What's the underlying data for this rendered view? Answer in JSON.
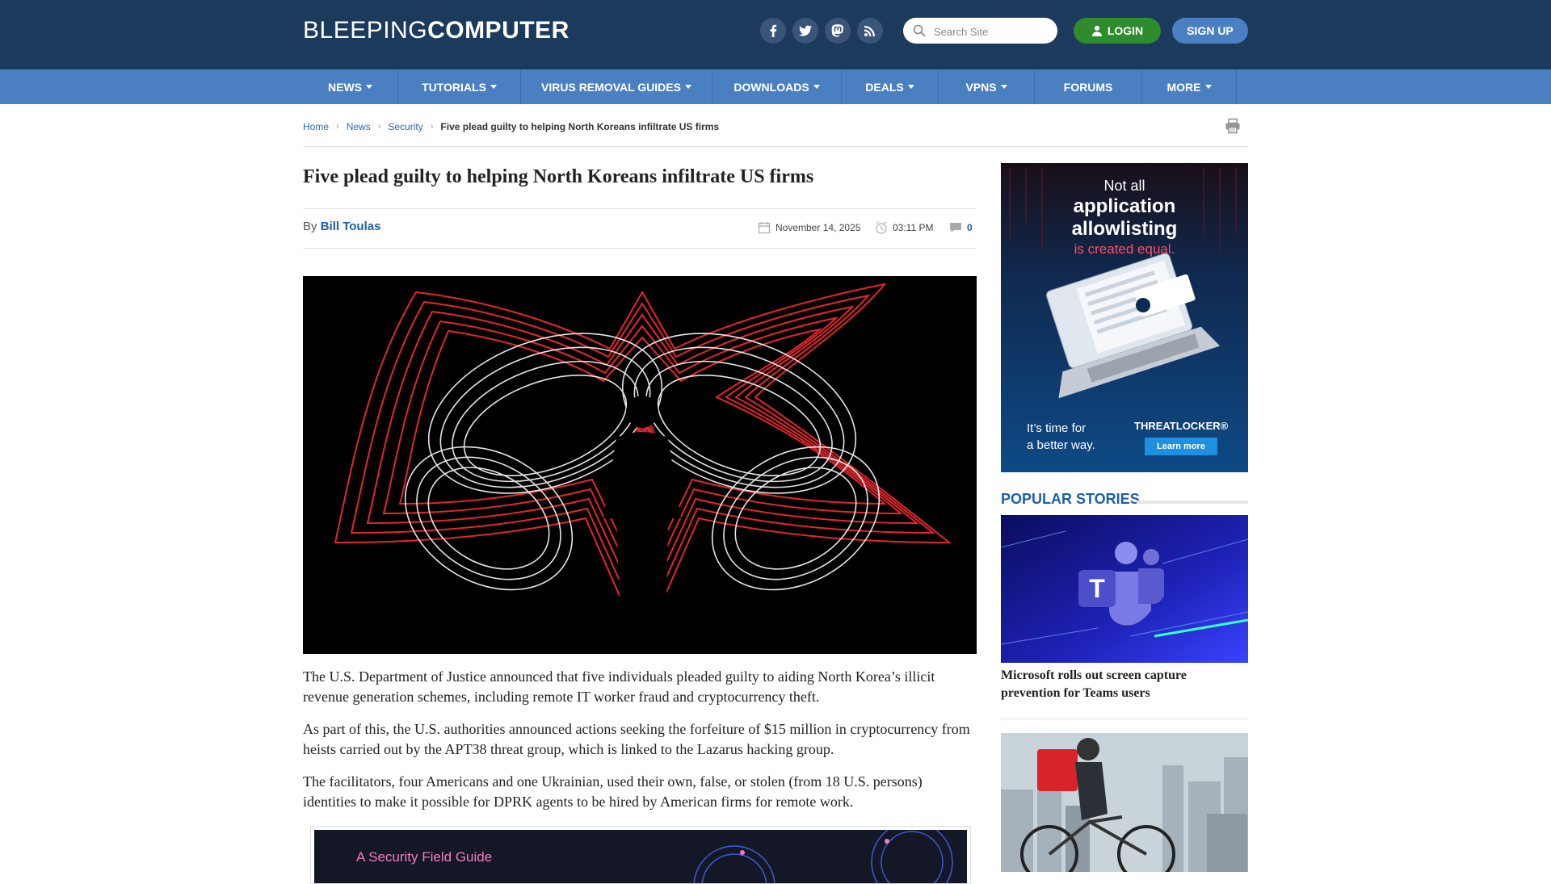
{
  "header": {
    "logo_light": "BLEEPING",
    "logo_bold": "COMPUTER",
    "social_icons": [
      "facebook-icon",
      "twitter-icon",
      "mastodon-icon",
      "rss-icon"
    ],
    "search_placeholder": "Search Site",
    "login_label": "LOGIN",
    "signup_label": "SIGN UP"
  },
  "nav": {
    "items": [
      {
        "label": "NEWS",
        "dropdown": true
      },
      {
        "label": "TUTORIALS",
        "dropdown": true
      },
      {
        "label": "VIRUS REMOVAL GUIDES",
        "dropdown": true
      },
      {
        "label": "DOWNLOADS",
        "dropdown": true
      },
      {
        "label": "DEALS",
        "dropdown": true
      },
      {
        "label": "VPNS",
        "dropdown": true
      },
      {
        "label": "FORUMS",
        "dropdown": false
      },
      {
        "label": "MORE",
        "dropdown": true
      }
    ]
  },
  "breadcrumb": {
    "items": [
      "Home",
      "News",
      "Security"
    ],
    "current": "Five plead guilty to helping North Koreans infiltrate US firms"
  },
  "article": {
    "title": "Five plead guilty to helping North Koreans infiltrate US firms",
    "by": "By",
    "author": "Bill Toulas",
    "date": "November 14, 2025",
    "time": "03:11 PM",
    "comments": "0",
    "paragraphs": [
      "The U.S. Department of Justice announced that five individuals pleaded guilty to aiding North Korea’s illicit revenue generation schemes, including remote IT worker fraud and cryptocurrency theft.",
      "As part of this, the U.S. authorities announced actions seeking the forfeiture of $15 million in cryptocurrency from heists carried out by the APT38 threat group, which is linked to the Lazarus hacking group.",
      "The facilitators, four Americans and one Ukrainian, used their own, false, or stolen (from 18 U.S. persons) identities to make it possible for DPRK agents to be hired by American firms for remote work."
    ],
    "promo_title": "A Security Field Guide"
  },
  "ad": {
    "line1": "Not all",
    "line2": "application",
    "line3": "allowlisting",
    "line4": "is created equal.",
    "tag1": "It’s time for",
    "tag2": "a better way.",
    "brand": "THREATLOCKER®",
    "cta": "Learn more"
  },
  "sidebar": {
    "popular_title": "POPULAR STORIES",
    "stories": [
      {
        "title": "Microsoft rolls out screen capture prevention for Teams users"
      }
    ]
  },
  "colors": {
    "header_bg": "#1c3a5c",
    "nav_bg": "#4a80c2",
    "link": "#2b68b0",
    "login_green": "#2e8b2e"
  }
}
